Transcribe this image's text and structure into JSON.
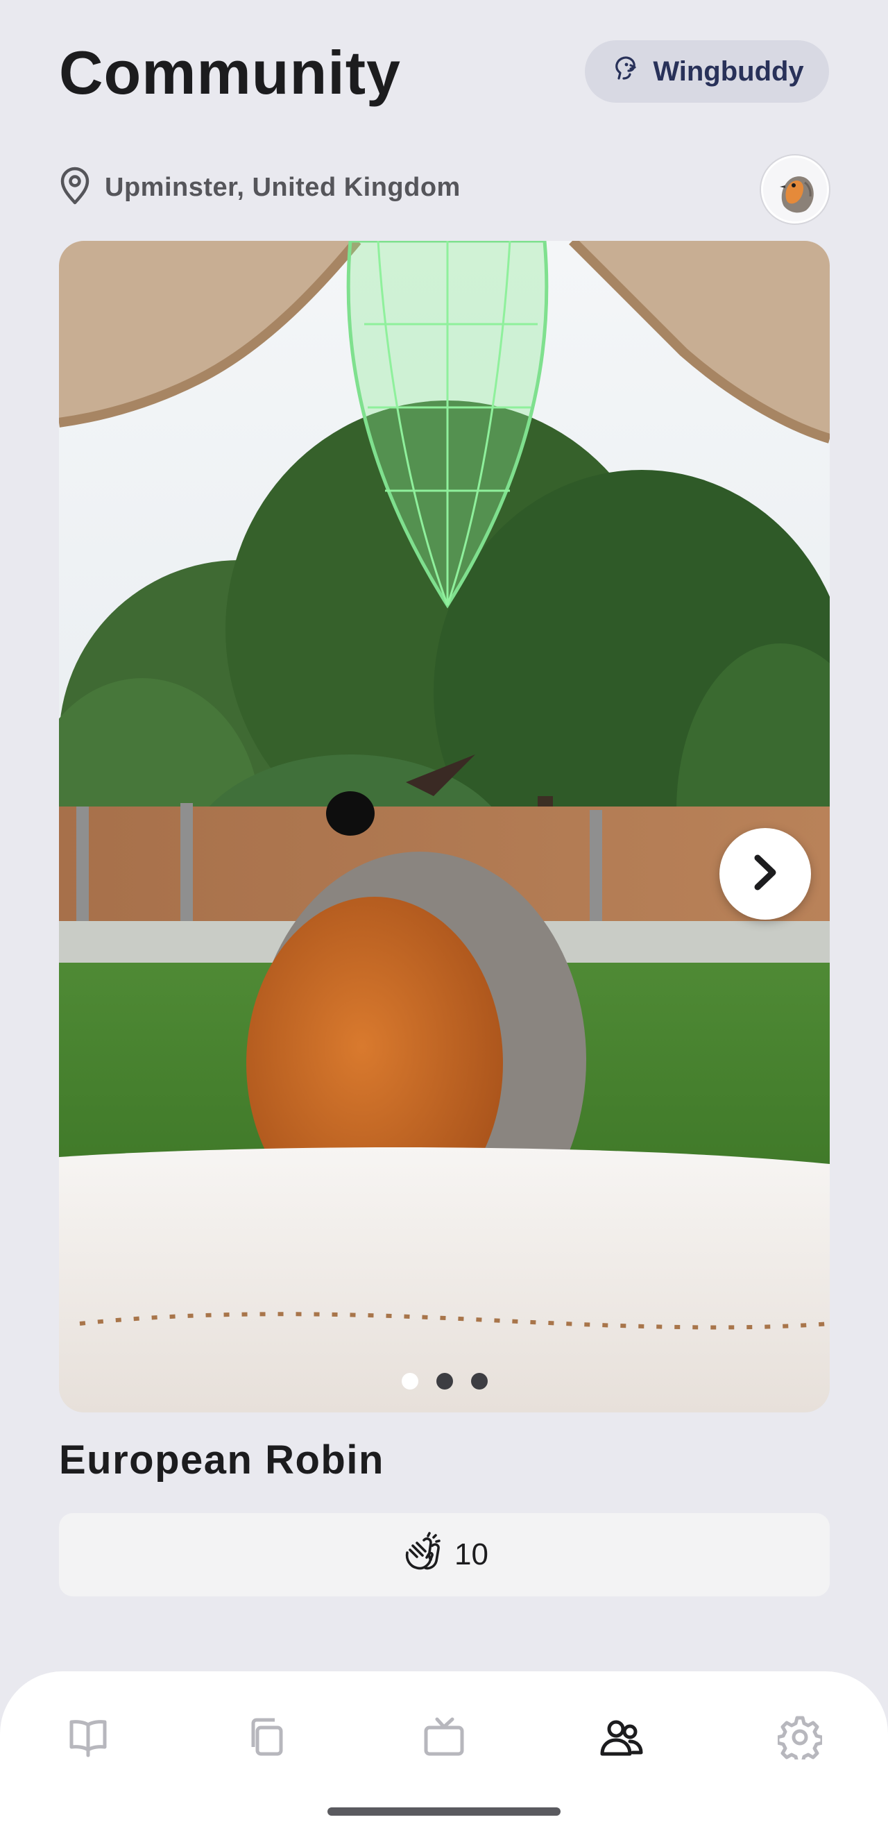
{
  "header": {
    "title": "Community",
    "wingbuddy_label": "Wingbuddy",
    "wingbuddy_icon": "parrot-icon"
  },
  "location": {
    "icon": "location-pin-icon",
    "text": "Upminster, United Kingdom"
  },
  "avatar": {
    "icon": "robin-avatar-icon"
  },
  "post": {
    "image": "photo-european-robin-on-feeder",
    "next_icon": "chevron-right-icon",
    "carousel_pages": 3,
    "carousel_active": 1,
    "species": "European Robin",
    "clap_icon": "clapping-hands-icon",
    "clap_count": "10"
  },
  "tabbar": {
    "items": [
      {
        "name": "guide",
        "icon": "book-icon",
        "active": false
      },
      {
        "name": "gallery",
        "icon": "cards-icon",
        "active": false
      },
      {
        "name": "live",
        "icon": "tv-icon",
        "active": false
      },
      {
        "name": "community",
        "icon": "people-icon",
        "active": true
      },
      {
        "name": "settings",
        "icon": "gear-icon",
        "active": false
      }
    ]
  },
  "colors": {
    "background": "#e9e9ef",
    "accent_navy": "#283159",
    "inactive_icon": "#b7b7bd",
    "active_icon": "#1c1c1e"
  }
}
